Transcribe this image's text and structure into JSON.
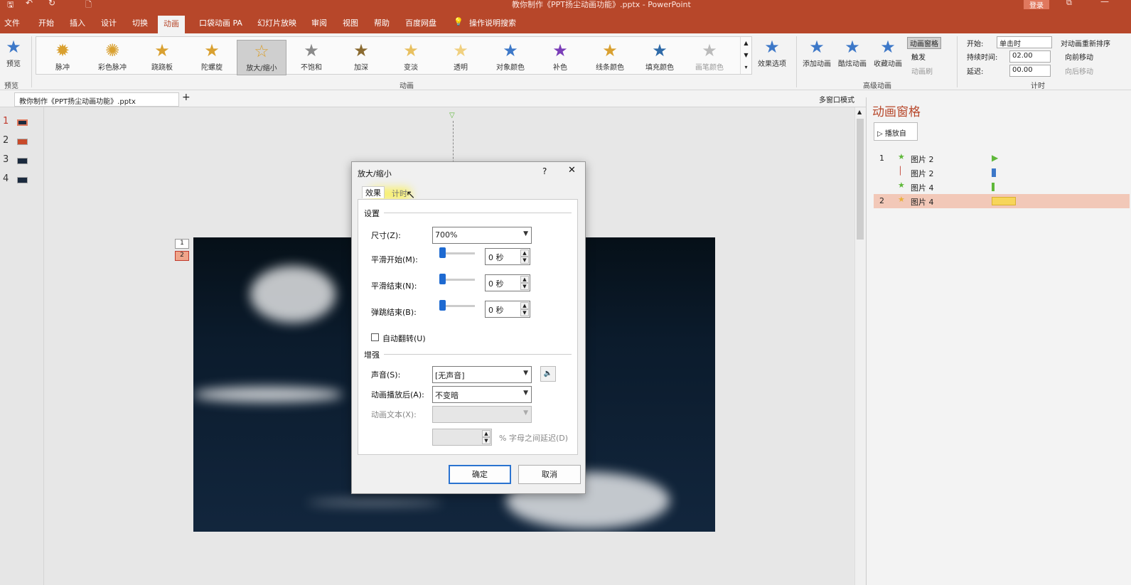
{
  "window": {
    "title": "教你制作《PPT扬尘动画功能》.pptx - PowerPoint",
    "login": "登录"
  },
  "menu_tabs": [
    "文件",
    "开始",
    "插入",
    "设计",
    "切换",
    "动画",
    "口袋动画 PA",
    "幻灯片放映",
    "审阅",
    "视图",
    "帮助",
    "百度网盘"
  ],
  "search_hint": "操作说明搜索",
  "ribbon": {
    "preview_label": "预览",
    "preview_group": "预览",
    "effects": [
      "脉冲",
      "彩色脉冲",
      "跷跷板",
      "陀螺旋",
      "放大/缩小",
      "不饱和",
      "加深",
      "变淡",
      "透明",
      "对象颜色",
      "补色",
      "线条颜色",
      "填充颜色",
      "画笔颜色"
    ],
    "effect_options": "效果选项",
    "animation_group": "动画",
    "add_animation": "添加动画",
    "cool_animation": "酷炫动画",
    "fav_animation": "收藏动画",
    "anim_pane_btn": "动画窗格",
    "trigger": "触发",
    "anim_painter": "动画刷",
    "advanced_group": "高级动画",
    "start_label": "开始:",
    "start_value": "单击时",
    "duration_label": "持续时间:",
    "duration_value": "02.00",
    "delay_label": "延迟:",
    "delay_value": "00.00",
    "reorder": "对动画重新排序",
    "move_earlier": "向前移动",
    "move_later": "向后移动",
    "timing_group": "计时"
  },
  "doc_tab": "教你制作《PPT扬尘动画功能》.pptx",
  "multiwin": "多窗口模式",
  "thumbnails": [
    "1",
    "2",
    "3",
    "4"
  ],
  "slide_markers": [
    "1",
    "2"
  ],
  "anim_pane": {
    "title": "动画窗格",
    "play_from": "播放自",
    "items": [
      {
        "index": "1",
        "name": "图片 2",
        "color": "#5fb83a"
      },
      {
        "index": "",
        "name": "图片 2",
        "color": "#3d78c8"
      },
      {
        "index": "",
        "name": "图片 4",
        "color": "#5fb83a"
      },
      {
        "index": "2",
        "name": "图片 4",
        "color": "#f7d55a"
      }
    ]
  },
  "dialog": {
    "title": "放大/缩小",
    "help": "?",
    "close": "✕",
    "tab_effect": "效果",
    "tab_timing": "计时",
    "section_settings": "设置",
    "size_label": "尺寸(Z):",
    "size_value": "700%",
    "smooth_start_label": "平滑开始(M):",
    "smooth_start_value": "0 秒",
    "smooth_end_label": "平滑结束(N):",
    "smooth_end_value": "0 秒",
    "bounce_end_label": "弹跳结束(B):",
    "bounce_end_value": "0 秒",
    "auto_reverse_label": "自动翻转(U)",
    "section_enhance": "增强",
    "sound_label": "声音(S):",
    "sound_value": "[无声音]",
    "after_anim_label": "动画播放后(A):",
    "after_anim_value": "不变暗",
    "anim_text_label": "动画文本(X):",
    "anim_text_value": "",
    "letter_delay_label": "% 字母之间延迟(D)",
    "ok": "确定",
    "cancel": "取消"
  }
}
